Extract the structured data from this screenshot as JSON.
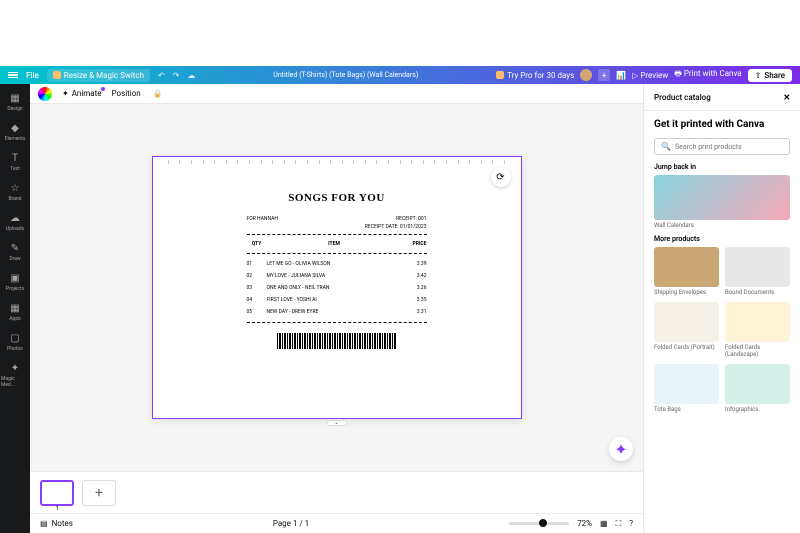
{
  "topbar": {
    "file": "File",
    "resize": "Resize & Magic Switch",
    "title": "Untitled (T-Shirts) (Tote Bags) (Wall Calendars)",
    "try_pro": "Try Pro for 30 days",
    "preview": "Preview",
    "print": "Print with Canva",
    "share": "Share"
  },
  "sidebar": {
    "items": [
      {
        "label": "Design"
      },
      {
        "label": "Elements"
      },
      {
        "label": "Text"
      },
      {
        "label": "Brand"
      },
      {
        "label": "Uploads"
      },
      {
        "label": "Draw"
      },
      {
        "label": "Projects"
      },
      {
        "label": "Apps"
      },
      {
        "label": "Photos"
      },
      {
        "label": "Magic Med..."
      }
    ]
  },
  "toolbar": {
    "animate": "Animate",
    "position": "Position"
  },
  "receipt": {
    "title": "SONGS FOR YOU",
    "for": "FOR HANNAH",
    "receipt_no": "RECEIPT: 001",
    "receipt_date": "RECEIPT DATE: 01/01/2023",
    "head_qty": "QTY",
    "head_item": "ITEM",
    "head_price": "PRICE",
    "rows": [
      {
        "qty": "01",
        "item": "LET ME GO - OLIVIA WILSON",
        "price": "3.39"
      },
      {
        "qty": "02",
        "item": "MY LOVE - JULIANA SILVA",
        "price": "3.42"
      },
      {
        "qty": "03",
        "item": "ONE AND ONLY - NEIL TRAN",
        "price": "3.26"
      },
      {
        "qty": "04",
        "item": "FIRST LOVE - YOSHI AI",
        "price": "3.35"
      },
      {
        "qty": "05",
        "item": "NEW DAY - DREW EYRE",
        "price": "3.31"
      }
    ]
  },
  "bottombar": {
    "notes": "Notes",
    "page": "Page 1 / 1",
    "zoom": "72%"
  },
  "panel": {
    "header": "Product catalog",
    "title": "Get it printed with Canva",
    "search_placeholder": "Search print products",
    "jump": "Jump back in",
    "jump_item": "Wall Calendars",
    "more": "More products",
    "products": [
      {
        "label": "Shipping Envelopes"
      },
      {
        "label": "Bound Documents"
      },
      {
        "label": "Folded Cards (Portrait)"
      },
      {
        "label": "Folded Cards (Landscape)"
      },
      {
        "label": "Tote Bags"
      },
      {
        "label": "Infographics"
      }
    ]
  }
}
